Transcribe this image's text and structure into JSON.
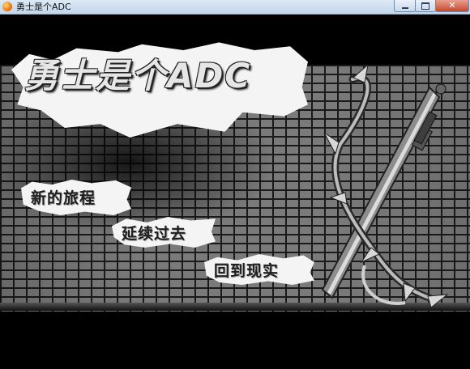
{
  "window": {
    "title": "勇士是个ADC",
    "icon": "app-orb-icon",
    "controls": {
      "minimize": "minimize-icon",
      "maximize": "maximize-icon",
      "close": "close-icon",
      "close_glyph": "✕"
    }
  },
  "game": {
    "title": "勇士是个ADC",
    "menu": {
      "new_game": "新的旅程",
      "continue": "延续过去",
      "exit": "回到现实"
    },
    "artwork": "crossed-swords-artwork"
  },
  "colors": {
    "titlebar": "#c3d6eb",
    "close_button": "#c9462c",
    "brick": "#7a7a7a",
    "mortar": "#1a1a1a",
    "paper": "#f4f4f4"
  }
}
